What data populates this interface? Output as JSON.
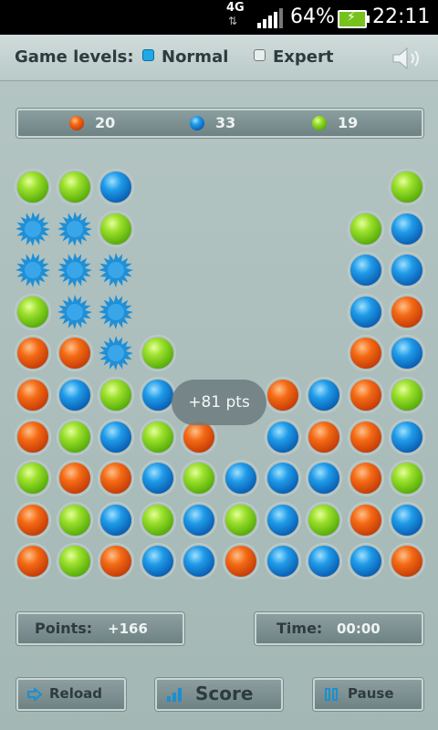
{
  "status_bar": {
    "network": "4G",
    "battery_percent": "64%",
    "battery_level": 0.64,
    "time": "22:11"
  },
  "header": {
    "levels_label": "Game levels:",
    "levels": [
      {
        "label": "Normal",
        "selected": true
      },
      {
        "label": "Expert",
        "selected": false
      }
    ],
    "sound_icon": "speaker-icon"
  },
  "counters": [
    {
      "color": "orange",
      "count": "20"
    },
    {
      "color": "blue",
      "count": "33"
    },
    {
      "color": "green",
      "count": "19"
    }
  ],
  "colors": {
    "green": "#7bcc1c",
    "blue": "#1477d4",
    "orange": "#e4520e",
    "splash": "#1f8fd6"
  },
  "board": {
    "columns": 10,
    "rows": 10,
    "grid": [
      [
        "green",
        "green",
        "blue",
        "",
        "",
        "",
        "",
        "",
        "",
        "green"
      ],
      [
        "splash",
        "splash",
        "green",
        "",
        "",
        "",
        "",
        "",
        "green",
        "blue"
      ],
      [
        "splash",
        "splash",
        "splash",
        "",
        "",
        "",
        "",
        "",
        "blue",
        "blue"
      ],
      [
        "green",
        "splash",
        "splash",
        "",
        "",
        "",
        "",
        "",
        "blue",
        "orange"
      ],
      [
        "orange",
        "orange",
        "splash",
        "green",
        "",
        "",
        "",
        "",
        "orange",
        "blue"
      ],
      [
        "orange",
        "blue",
        "green",
        "blue",
        "",
        "",
        "orange",
        "blue",
        "orange",
        "green"
      ],
      [
        "orange",
        "green",
        "blue",
        "green",
        "orange",
        "",
        "blue",
        "orange",
        "orange",
        "blue"
      ],
      [
        "green",
        "orange",
        "orange",
        "blue",
        "green",
        "blue",
        "blue",
        "blue",
        "orange",
        "green"
      ],
      [
        "orange",
        "green",
        "blue",
        "green",
        "blue",
        "green",
        "blue",
        "green",
        "orange",
        "blue"
      ],
      [
        "orange",
        "green",
        "orange",
        "blue",
        "blue",
        "orange",
        "blue",
        "blue",
        "blue",
        "orange"
      ]
    ]
  },
  "toast": "+81 pts",
  "points": {
    "label": "Points:",
    "value": "+166"
  },
  "time": {
    "label": "Time:",
    "value": "00:00"
  },
  "buttons": {
    "reload": "Reload",
    "score": "Score",
    "pause": "Pause"
  }
}
